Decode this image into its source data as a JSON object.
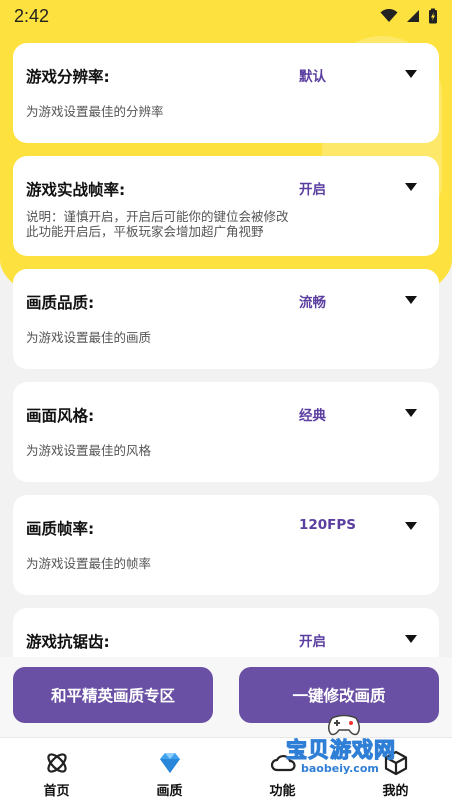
{
  "status": {
    "time": "2:42"
  },
  "settings": [
    {
      "title": "游戏分辨率:",
      "value": "默认",
      "desc": [
        "为游戏设置最佳的分辨率"
      ]
    },
    {
      "title": "游戏实战帧率:",
      "value": "开启",
      "desc": [
        "说明：谨慎开启，开启后可能你的键位会被修改",
        "此功能开启后，平板玩家会增加超广角视野"
      ]
    },
    {
      "title": "画质品质:",
      "value": "流畅",
      "desc": [
        "为游戏设置最佳的画质"
      ]
    },
    {
      "title": "画面风格:",
      "value": "经典",
      "desc": [
        "为游戏设置最佳的风格"
      ]
    },
    {
      "title": "画质帧率:",
      "value": "120FPS",
      "desc": [
        "为游戏设置最佳的帧率"
      ]
    },
    {
      "title": "游戏抗锯齿:",
      "value": "开启",
      "desc": []
    }
  ],
  "buttons": {
    "left": "和平精英画质专区",
    "right": "一键修改画质"
  },
  "tabs": [
    {
      "label": "首页",
      "icon": "atom-icon"
    },
    {
      "label": "画质",
      "icon": "gem-icon"
    },
    {
      "label": "功能",
      "icon": "cloud-icon"
    },
    {
      "label": "我的",
      "icon": "cube-icon"
    }
  ],
  "watermark": {
    "text": "宝贝游戏网",
    "url": "baobeiy.com"
  },
  "colors": {
    "accent": "#6a50a4",
    "yellow": "#fde23f",
    "value_text": "#5b3fa0"
  }
}
